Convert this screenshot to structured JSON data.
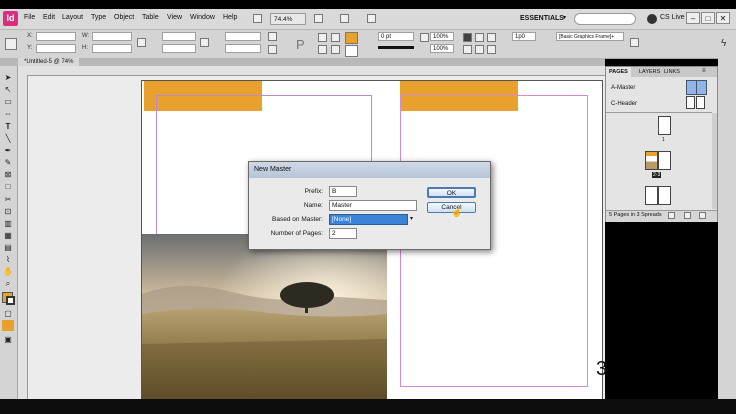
{
  "app": {
    "logo": "Id"
  },
  "menu": [
    "File",
    "Edit",
    "Layout",
    "Type",
    "Object",
    "Table",
    "View",
    "Window",
    "Help"
  ],
  "appbar": {
    "zoom": "74.4%",
    "workspace": "ESSENTIALS",
    "cs_live": "CS Live"
  },
  "control": {
    "x_label": "X:",
    "y_label": "Y:",
    "w_label": "W:",
    "h_label": "H:",
    "stroke": "0 pt",
    "zoom_pct": "100%",
    "zoom_pct2": "100%",
    "corner": "1p0",
    "frame_style": "[Basic Graphics Frame]+"
  },
  "document": {
    "tab": "*Untitled-5 @ 74%",
    "page_number": "3"
  },
  "dialog": {
    "title": "New Master",
    "prefix_label": "Prefix:",
    "prefix_value": "B",
    "name_label": "Name:",
    "name_value": "Master",
    "based_label": "Based on Master:",
    "based_value": "[None]",
    "pages_label": "Number of Pages:",
    "pages_value": "2",
    "ok_label": "OK",
    "cancel_label": "Cancel"
  },
  "pages_panel": {
    "tab_pages": "PAGES",
    "tab_layers": "LAYERS",
    "tab_links": "LINKS",
    "masters": [
      "A-Master",
      "C-Header"
    ],
    "page_labels": [
      "1",
      "2-3"
    ],
    "footer": "5 Pages in 3 Spreads"
  },
  "colors": {
    "accent_orange": "#e7a12c",
    "logo": "#d8307c"
  }
}
